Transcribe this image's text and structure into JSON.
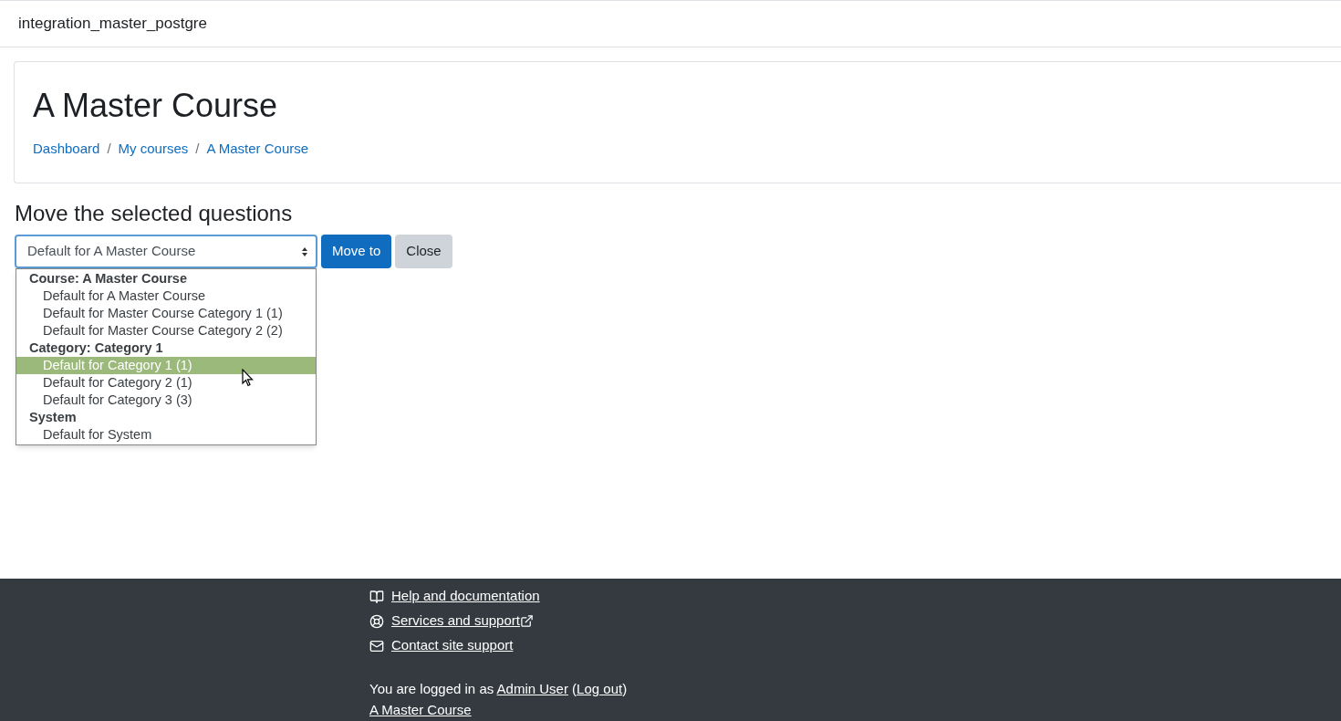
{
  "navbar": {
    "site_name": "integration_master_postgre"
  },
  "header": {
    "title": "A Master Course",
    "breadcrumbs": [
      {
        "label": "Dashboard"
      },
      {
        "label": "My courses"
      },
      {
        "label": "A Master Course"
      }
    ],
    "separator": "/"
  },
  "move_form": {
    "heading": "Move the selected questions",
    "select_value": "Default for A Master Course",
    "buttons": [
      {
        "label": "Move to",
        "kind": "primary"
      },
      {
        "label": "Close",
        "kind": "secondary"
      }
    ],
    "options": [
      {
        "kind": "group",
        "label": "Course: A Master Course",
        "selected": false
      },
      {
        "kind": "option",
        "label": "Default for A Master Course",
        "selected": false
      },
      {
        "kind": "option",
        "label": "Default for Master Course Category 1 (1)",
        "selected": false
      },
      {
        "kind": "option",
        "label": "Default for Master Course Category 2 (2)",
        "selected": false
      },
      {
        "kind": "group",
        "label": "Category: Category 1",
        "selected": false
      },
      {
        "kind": "option",
        "label": "Default for Category 1 (1)",
        "selected": true
      },
      {
        "kind": "option",
        "label": "Default for Category 2 (1)",
        "selected": false
      },
      {
        "kind": "option",
        "label": "Default for Category 3 (3)",
        "selected": false
      },
      {
        "kind": "group",
        "label": "System",
        "selected": false
      },
      {
        "kind": "option",
        "label": "Default for System",
        "selected": false
      }
    ]
  },
  "footer": {
    "links": [
      {
        "label": "Help and documentation",
        "kind": "book",
        "external": false
      },
      {
        "label": "Services and support",
        "kind": "lifebuoy",
        "external": true
      },
      {
        "label": "Contact site support",
        "kind": "envelope",
        "external": false
      }
    ],
    "login_info": [
      {
        "kind": "text",
        "text": "You are logged in as "
      },
      {
        "kind": "link",
        "text": "Admin User"
      },
      {
        "kind": "text",
        "text": " ("
      },
      {
        "kind": "link",
        "text": "Log out"
      },
      {
        "kind": "text",
        "text": ")"
      }
    ],
    "course_link": "A Master Course"
  }
}
